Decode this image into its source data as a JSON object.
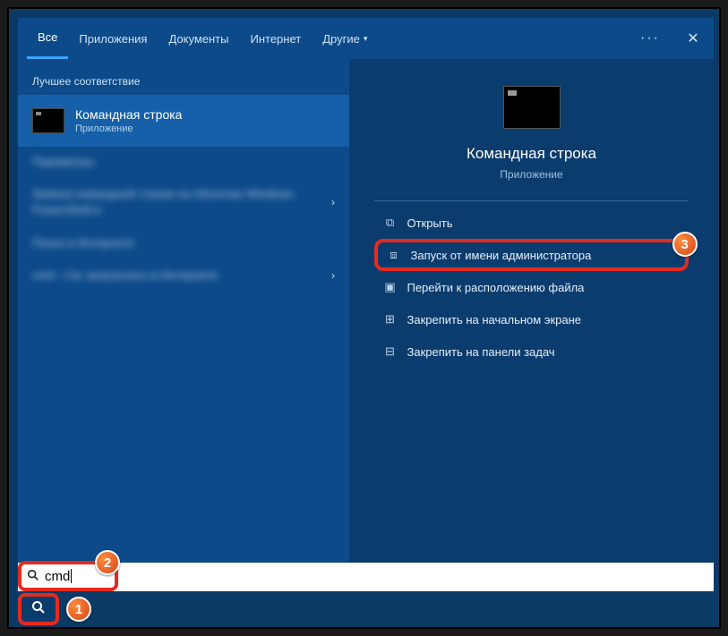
{
  "tabs": {
    "items": [
      "Все",
      "Приложения",
      "Документы",
      "Интернет",
      "Другие"
    ],
    "active_index": 0
  },
  "left": {
    "best_match_header": "Лучшее соответствие",
    "result": {
      "title": "Командная строка",
      "subtitle": "Приложение"
    },
    "blur1_header": "Параметры",
    "blur1_line": "Замена командной строки на оболочку Windows PowerShell в",
    "blur2_header": "Поиск в Интернете",
    "blur2_line": "cmd - См. результаты в Интернете"
  },
  "right": {
    "title": "Командная строка",
    "subtitle": "Приложение",
    "actions": [
      {
        "icon": "open-icon",
        "glyph": "⧉",
        "label": "Открыть"
      },
      {
        "icon": "admin-icon",
        "glyph": "⧈",
        "label": "Запуск от имени администратора"
      },
      {
        "icon": "folder-icon",
        "glyph": "▣",
        "label": "Перейти к расположению файла"
      },
      {
        "icon": "pin-start-icon",
        "glyph": "⊞",
        "label": "Закрепить на начальном экране"
      },
      {
        "icon": "pin-taskbar-icon",
        "glyph": "⊟",
        "label": "Закрепить на панели задач"
      }
    ],
    "highlight_index": 1
  },
  "search": {
    "query": "cmd"
  },
  "badges": {
    "b1": "1",
    "b2": "2",
    "b3": "3"
  }
}
